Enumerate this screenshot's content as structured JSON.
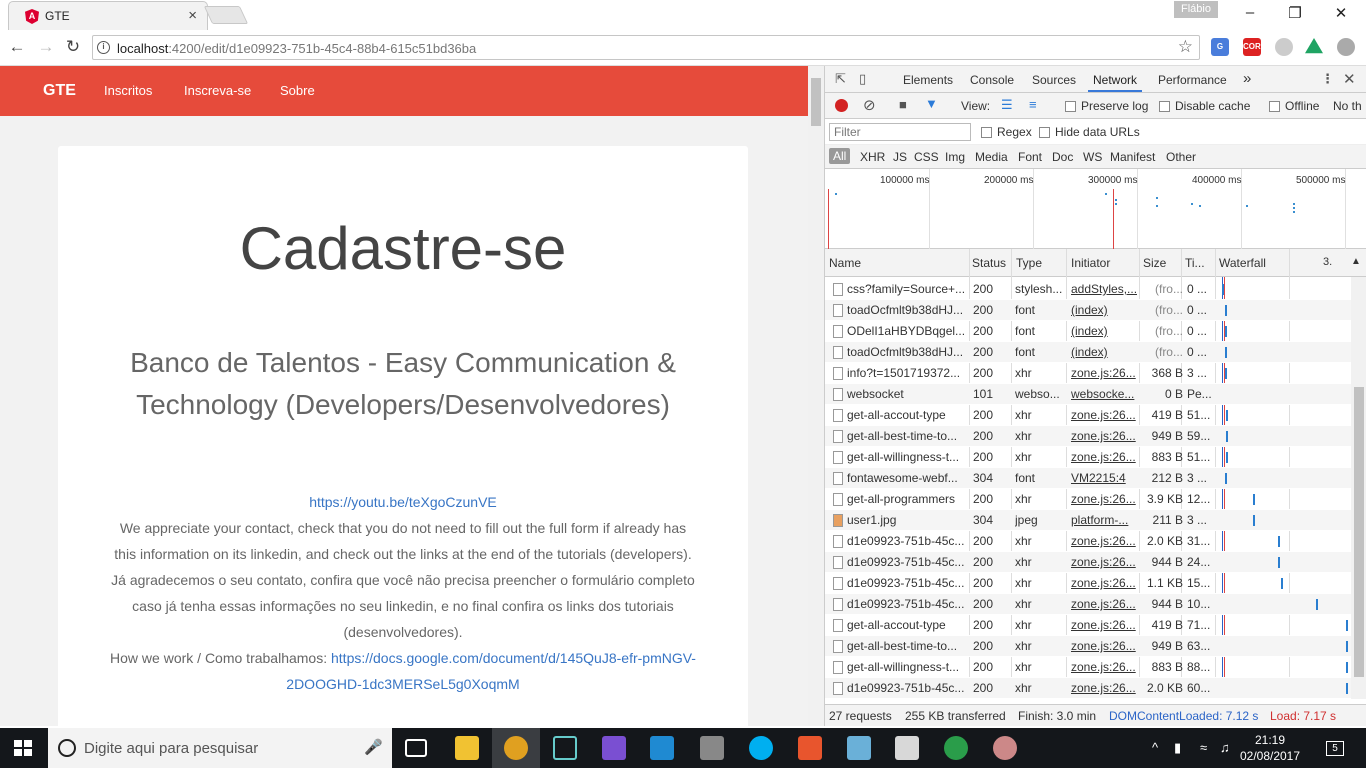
{
  "browser": {
    "tab_title": "GTE",
    "tab_close": "×",
    "user_name": "Flábio",
    "url_host": "localhost",
    "url_rest": ":4200/edit/d1e09923-751b-45c4-88b4-615c51bd36ba",
    "ext_cors": "CORS"
  },
  "site": {
    "brand": "GTE",
    "nav": [
      "Inscritos",
      "Inscreva-se",
      "Sobre"
    ],
    "title": "Cadastre-se",
    "subtitle": "Banco de Talentos - Easy Communication & Technology (Developers/Desenvolvedores)",
    "link1": "https://youtu.be/teXgoCzunVE",
    "para_en": "We appreciate your contact, check that you do not need to fill out the full form if already has this information on its linkedin, and check out the links at the end of the tutorials (developers).",
    "para_pt": "Já agradecemos o seu contato, confira que você não precisa preencher o formulário completo caso já tenha essas informações no seu linkedin, e no final confira os links dos tutoriais (desenvolvedores).",
    "how_label": "How we work / Como trabalhamos: ",
    "how_link": "https://docs.google.com/document/d/145QuJ8-efr-pmNGV-2DOOGHD-1dc3MERSeL5g0XoqmM"
  },
  "devtools": {
    "tabs": [
      "Elements",
      "Console",
      "Sources",
      "Network",
      "Performance"
    ],
    "active_tab": "Network",
    "more_tabs": "»",
    "view_label": "View:",
    "preserve_log": "Preserve log",
    "disable_cache": "Disable cache",
    "offline": "Offline",
    "no_throttling": "No th",
    "filter_placeholder": "Filter",
    "regex": "Regex",
    "hide_data_urls": "Hide data URLs",
    "types": [
      "All",
      "XHR",
      "JS",
      "CSS",
      "Img",
      "Media",
      "Font",
      "Doc",
      "WS",
      "Manifest",
      "Other"
    ],
    "ticks": [
      "100000 ms",
      "200000 ms",
      "300000 ms",
      "400000 ms",
      "500000 ms"
    ],
    "columns": {
      "name": "Name",
      "status": "Status",
      "type": "Type",
      "initiator": "Initiator",
      "size": "Size",
      "time": "Ti...",
      "waterfall": "Waterfall",
      "extra": "3."
    },
    "rows": [
      {
        "name": "css?family=Source+...",
        "status": "200",
        "type": "stylesh...",
        "initiator": "addStyles,...",
        "size": "(fro...",
        "time": "0 ...",
        "wf": 0.01,
        "icon": "doc"
      },
      {
        "name": "toadOcfmlt9b38dHJ...",
        "status": "200",
        "type": "font",
        "initiator": "(index)",
        "size": "(fro...",
        "time": "0 ...",
        "wf": 0.03,
        "icon": "doc"
      },
      {
        "name": "ODelI1aHBYDBqgel...",
        "status": "200",
        "type": "font",
        "initiator": "(index)",
        "size": "(fro...",
        "time": "0 ...",
        "wf": 0.03,
        "icon": "doc"
      },
      {
        "name": "toadOcfmlt9b38dHJ...",
        "status": "200",
        "type": "font",
        "initiator": "(index)",
        "size": "(fro...",
        "time": "0 ...",
        "wf": 0.03,
        "icon": "doc"
      },
      {
        "name": "info?t=1501719372...",
        "status": "200",
        "type": "xhr",
        "initiator": "zone.js:26...",
        "size": "368 B",
        "time": "3 ...",
        "wf": 0.03,
        "icon": "doc"
      },
      {
        "name": "websocket",
        "status": "101",
        "type": "webso...",
        "initiator": "websocke...",
        "size": "0 B",
        "time": "Pe...",
        "wf": -1,
        "icon": "doc"
      },
      {
        "name": "get-all-accout-type",
        "status": "200",
        "type": "xhr",
        "initiator": "zone.js:26...",
        "size": "419 B",
        "time": "51...",
        "wf": 0.04,
        "icon": "doc"
      },
      {
        "name": "get-all-best-time-to...",
        "status": "200",
        "type": "xhr",
        "initiator": "zone.js:26...",
        "size": "949 B",
        "time": "59...",
        "wf": 0.04,
        "icon": "doc"
      },
      {
        "name": "get-all-willingness-t...",
        "status": "200",
        "type": "xhr",
        "initiator": "zone.js:26...",
        "size": "883 B",
        "time": "51...",
        "wf": 0.04,
        "icon": "doc"
      },
      {
        "name": "fontawesome-webf...",
        "status": "304",
        "type": "font",
        "initiator": "VM2215:4",
        "size": "212 B",
        "time": "3 ...",
        "wf": 0.03,
        "icon": "doc"
      },
      {
        "name": "get-all-programmers",
        "status": "200",
        "type": "xhr",
        "initiator": "zone.js:26...",
        "size": "3.9 KB",
        "time": "12...",
        "wf": 0.25,
        "icon": "doc"
      },
      {
        "name": "user1.jpg",
        "status": "304",
        "type": "jpeg",
        "initiator": "platform-...",
        "size": "211 B",
        "time": "3 ...",
        "wf": 0.25,
        "icon": "img"
      },
      {
        "name": "d1e09923-751b-45c...",
        "status": "200",
        "type": "xhr",
        "initiator": "zone.js:26...",
        "size": "2.0 KB",
        "time": "31...",
        "wf": 0.45,
        "icon": "doc"
      },
      {
        "name": "d1e09923-751b-45c...",
        "status": "200",
        "type": "xhr",
        "initiator": "zone.js:26...",
        "size": "944 B",
        "time": "24...",
        "wf": 0.45,
        "icon": "doc"
      },
      {
        "name": "d1e09923-751b-45c...",
        "status": "200",
        "type": "xhr",
        "initiator": "zone.js:26...",
        "size": "1.1 KB",
        "time": "15...",
        "wf": 0.48,
        "icon": "doc"
      },
      {
        "name": "d1e09923-751b-45c...",
        "status": "200",
        "type": "xhr",
        "initiator": "zone.js:26...",
        "size": "944 B",
        "time": "10...",
        "wf": 0.75,
        "icon": "doc"
      },
      {
        "name": "get-all-accout-type",
        "status": "200",
        "type": "xhr",
        "initiator": "zone.js:26...",
        "size": "419 B",
        "time": "71...",
        "wf": 0.99,
        "icon": "doc"
      },
      {
        "name": "get-all-best-time-to...",
        "status": "200",
        "type": "xhr",
        "initiator": "zone.js:26...",
        "size": "949 B",
        "time": "63...",
        "wf": 0.99,
        "icon": "doc"
      },
      {
        "name": "get-all-willingness-t...",
        "status": "200",
        "type": "xhr",
        "initiator": "zone.js:26...",
        "size": "883 B",
        "time": "88...",
        "wf": 0.99,
        "icon": "doc"
      },
      {
        "name": "d1e09923-751b-45c...",
        "status": "200",
        "type": "xhr",
        "initiator": "zone.js:26...",
        "size": "2.0 KB",
        "time": "60...",
        "wf": 0.99,
        "icon": "doc"
      }
    ],
    "summary": {
      "requests": "27 requests",
      "transferred": "255 KB transferred",
      "finish": "Finish: 3.0 min",
      "dcl": "DOMContentLoaded: 7.12 s",
      "load": "Load: 7.17 s"
    }
  },
  "taskbar": {
    "search_placeholder": "Digite aqui para pesquisar",
    "time": "21:19",
    "date": "02/08/2017",
    "notifications": "5"
  },
  "colors": {
    "accent": "#e64b3b",
    "link": "#3875c5",
    "dcl": "#2b64c7",
    "load": "#d03030"
  }
}
